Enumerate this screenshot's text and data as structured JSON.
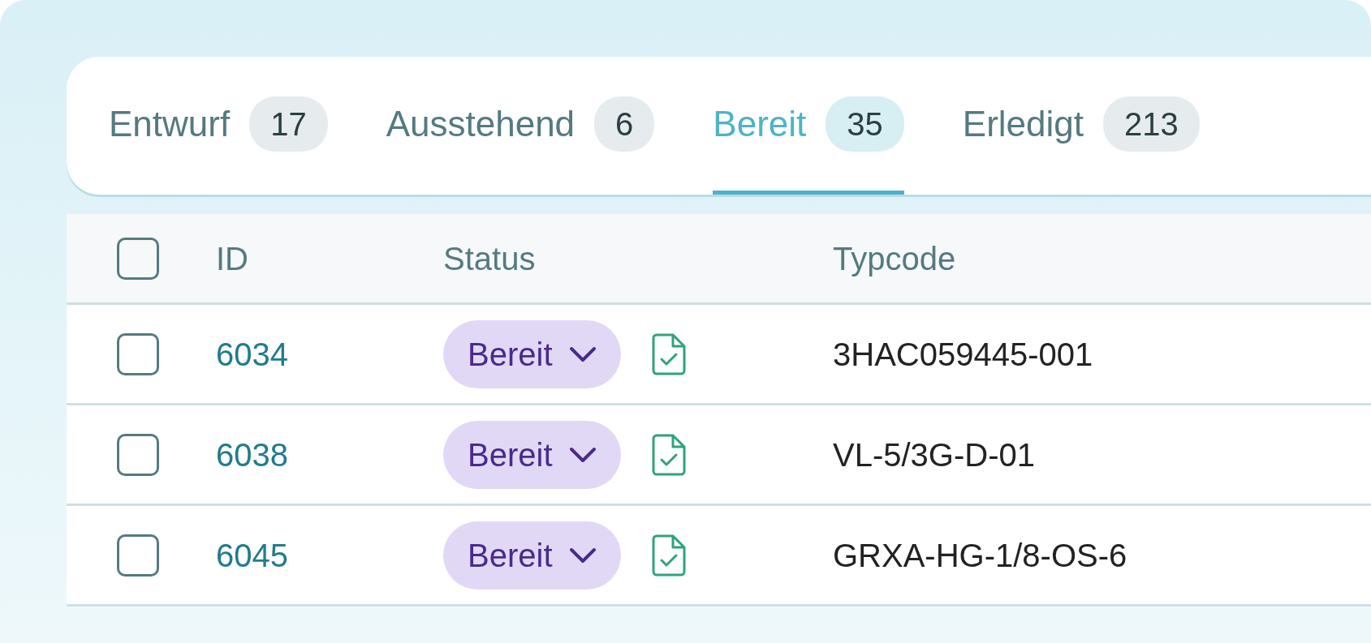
{
  "tabs": [
    {
      "label": "Entwurf",
      "count": "17",
      "selected": false
    },
    {
      "label": "Ausstehend",
      "count": "6",
      "selected": false
    },
    {
      "label": "Bereit",
      "count": "35",
      "selected": true
    },
    {
      "label": "Erledigt",
      "count": "213",
      "selected": false
    }
  ],
  "table": {
    "select_all": {
      "checked": false
    },
    "columns": [
      "ID",
      "Status",
      "Typcode"
    ],
    "rows": [
      {
        "checked": false,
        "id": "6034",
        "status": "Bereit",
        "typcode": "3HAC059445-001"
      },
      {
        "checked": false,
        "id": "6038",
        "status": "Bereit",
        "typcode": "VL-5/3G-D-01"
      },
      {
        "checked": false,
        "id": "6045",
        "status": "Bereit",
        "typcode": "GRXA-HG-1/8-OS-6"
      }
    ]
  }
}
